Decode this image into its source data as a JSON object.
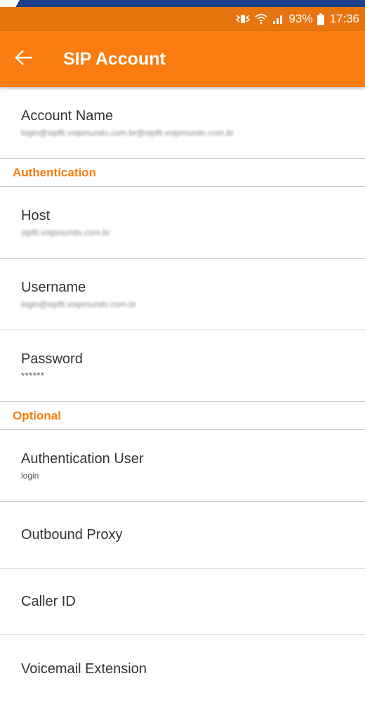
{
  "status_bar": {
    "battery": "93%",
    "time": "17:36",
    "icons": [
      "vibrate-icon",
      "wifi-icon",
      "signal-icon",
      "battery-icon"
    ]
  },
  "app_bar": {
    "title": "SIP Account",
    "back_icon": "arrow-back-icon",
    "color": "#fb7c10"
  },
  "items": {
    "account_name": {
      "title": "Account Name",
      "summary": "login@sipflt.voipmundo.com.br@sipflt.voipmundo.com.br"
    },
    "host": {
      "title": "Host",
      "summary": "sipflt.voipmundo.com.br"
    },
    "username": {
      "title": "Username",
      "summary": "login@sipflt.voipmundo.com.br"
    },
    "password": {
      "title": "Password",
      "summary": "******"
    },
    "auth_user": {
      "title": "Authentication User",
      "summary": "login"
    },
    "outbound_proxy": {
      "title": "Outbound Proxy"
    },
    "caller_id": {
      "title": "Caller ID"
    },
    "voicemail_extension": {
      "title": "Voicemail Extension"
    }
  },
  "sections": {
    "authentication": "Authentication",
    "optional": "Optional"
  }
}
